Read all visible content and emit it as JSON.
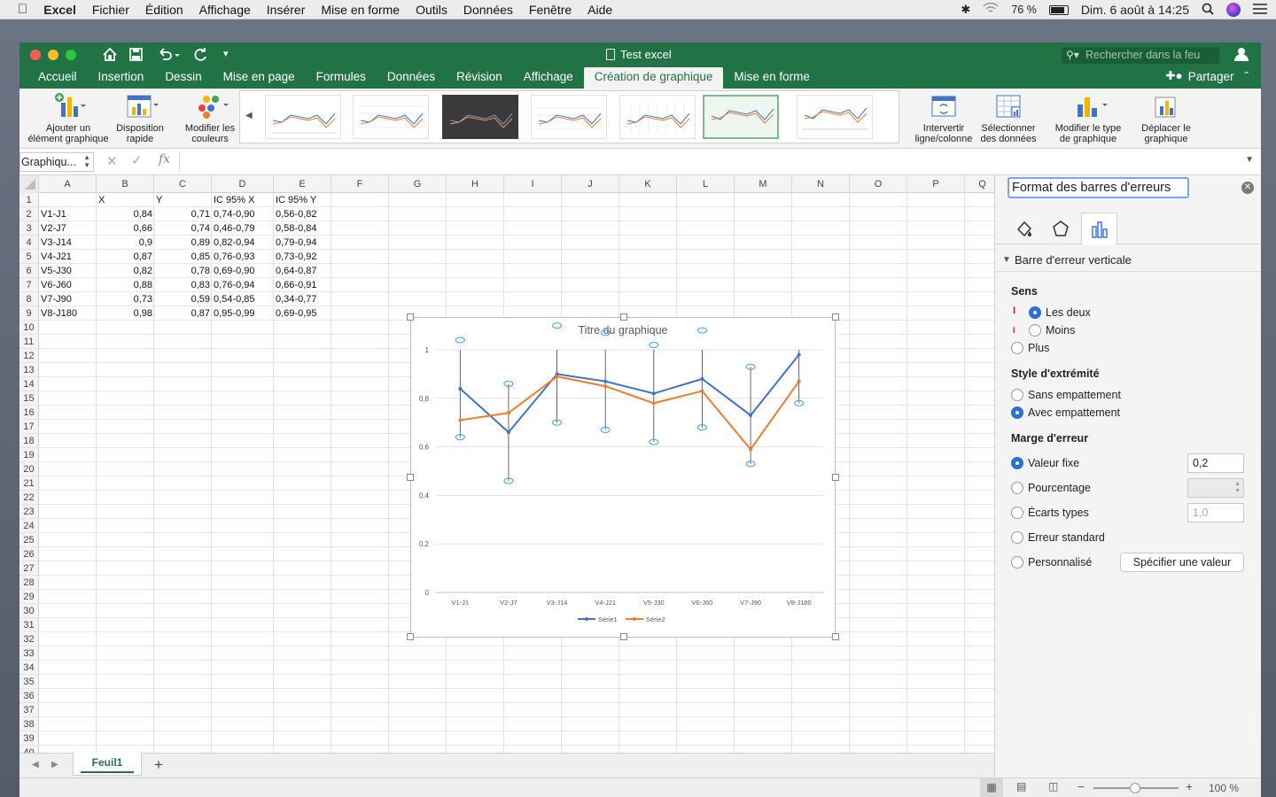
{
  "menubar": {
    "app": "Excel",
    "items": [
      "Fichier",
      "Édition",
      "Affichage",
      "Insérer",
      "Mise en forme",
      "Outils",
      "Données",
      "Fenêtre",
      "Aide"
    ],
    "battery": "76 %",
    "datetime": "Dim. 6 août à  14:25"
  },
  "window": {
    "title": "Test excel",
    "search_placeholder": "Rechercher dans la feu",
    "share_label": "Partager"
  },
  "tabs": [
    "Accueil",
    "Insertion",
    "Dessin",
    "Mise en page",
    "Formules",
    "Données",
    "Révision",
    "Affichage",
    "Création de graphique",
    "Mise en forme"
  ],
  "active_tab": "Création de graphique",
  "ribbon": {
    "add_element": [
      "Ajouter un",
      "élément graphique"
    ],
    "quick_layout": [
      "Disposition",
      "rapide"
    ],
    "change_colors": [
      "Modifier les",
      "couleurs"
    ],
    "switch_row_col": [
      "Intervertir",
      "ligne/colonne"
    ],
    "select_data": [
      "Sélectionner",
      "des données"
    ],
    "change_type": [
      "Modifier le type",
      "de graphique"
    ],
    "move_chart": [
      "Déplacer le",
      "graphique"
    ]
  },
  "formula_bar": {
    "name_box": "Graphiqu...",
    "fx": "fx",
    "content": ""
  },
  "columns": [
    "A",
    "B",
    "C",
    "D",
    "E",
    "F",
    "G",
    "H",
    "I",
    "J",
    "K",
    "L",
    "M",
    "N",
    "O",
    "P",
    "Q"
  ],
  "rows_count": 40,
  "sheet": {
    "headers": [
      "",
      "X",
      "Y",
      "IC 95% X",
      "IC 95% Y"
    ],
    "rows": [
      [
        "V1-J1",
        "0,84",
        "0,71",
        "0,74-0,90",
        "0,56-0,82"
      ],
      [
        "V2-J7",
        "0,66",
        "0,74",
        "0,46-0,79",
        "0,58-0,84"
      ],
      [
        "V3-J14",
        "0,9",
        "0,89",
        "0,82-0,94",
        "0,79-0,94"
      ],
      [
        "V4-J21",
        "0,87",
        "0,85",
        "0,76-0,93",
        "0,73-0,92"
      ],
      [
        "V5-J30",
        "0,82",
        "0,78",
        "0,69-0,90",
        "0,64-0,87"
      ],
      [
        "V6-J60",
        "0,88",
        "0,83",
        "0,76-0,94",
        "0,66-0,91"
      ],
      [
        "V7-J90",
        "0,73",
        "0,59",
        "0,54-0,85",
        "0,34-0,77"
      ],
      [
        "V8-J180",
        "0,98",
        "0,87",
        "0,95-0,99",
        "0,69-0,95"
      ]
    ]
  },
  "chart_data": {
    "type": "line",
    "title": "Titre du graphique",
    "categories": [
      "V1-J1",
      "V2-J7",
      "V3-J14",
      "V4-J21",
      "V5-J30",
      "V6-J60",
      "V7-J90",
      "V8-J180"
    ],
    "series": [
      {
        "name": "Série1",
        "values": [
          0.84,
          0.66,
          0.9,
          0.87,
          0.82,
          0.88,
          0.73,
          0.98
        ],
        "color": "#4472c4"
      },
      {
        "name": "Série2",
        "values": [
          0.71,
          0.74,
          0.89,
          0.85,
          0.78,
          0.83,
          0.59,
          0.87
        ],
        "color": "#ed7d31"
      }
    ],
    "error_bar": {
      "fixed_value": 0.2,
      "direction": "both",
      "end_style": "cap"
    },
    "yticks": [
      "0",
      "0,2",
      "0,4",
      "0,6",
      "0,8",
      "1"
    ],
    "ylim": [
      0,
      1
    ],
    "legend": "bottom",
    "grid": true
  },
  "sheet_tabs": {
    "active": "Feuil1",
    "add": "+"
  },
  "status": {
    "zoom": "100 %"
  },
  "panel": {
    "title": "Format des barres d'erreurs",
    "section": "Barre d'erreur verticale",
    "sens_label": "Sens",
    "sens_options": [
      "Les deux",
      "Moins",
      "Plus"
    ],
    "sens_selected": 0,
    "style_label": "Style d'extrémité",
    "style_options": [
      "Sans empattement",
      "Avec empattement"
    ],
    "style_selected": 1,
    "marge_label": "Marge d'erreur",
    "marge_options": [
      "Valeur fixe",
      "Pourcentage",
      "Écarts types",
      "Erreur standard",
      "Personnalisé"
    ],
    "marge_selected": 0,
    "fixed_value": "0,2",
    "std_value": "1,0",
    "specify_button": "Spécifier une valeur"
  }
}
